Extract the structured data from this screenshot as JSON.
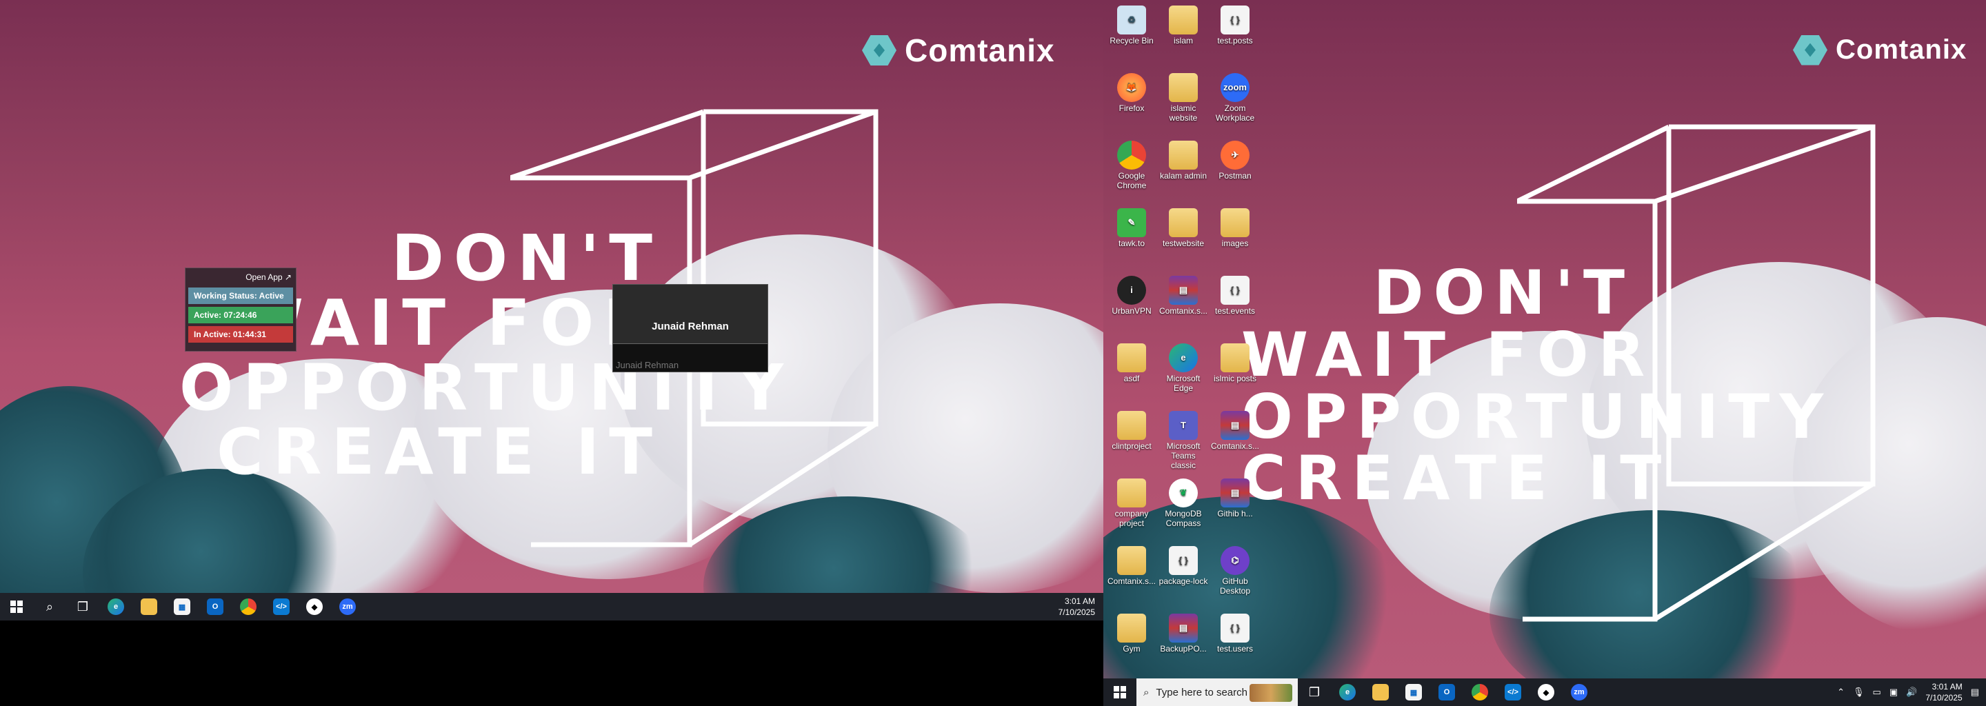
{
  "left_monitor": {
    "logo": "Comtanix",
    "quote": [
      "DON'T",
      "WAIT FOR",
      "OPPORTUNITY",
      "CREATE IT"
    ],
    "widget": {
      "open_app": "Open App ↗",
      "status": "Working Status: Active",
      "active": "Active: 07:24:46",
      "inactive": "In Active: 01:44:31",
      "colors": {
        "status": "#5e8fa3",
        "active": "#3aa35a",
        "inactive": "#c43a3a"
      }
    },
    "preview": {
      "title": "Junaid Rehman",
      "subtitle": "Junaid Rehman"
    },
    "taskbar": {
      "apps": [
        "start-icon",
        "search-icon",
        "task-view-icon",
        "edge-icon",
        "file-explorer-icon",
        "store-icon",
        "outlook-icon",
        "chrome-icon",
        "vscode-icon",
        "urbanvpn-icon",
        "zoom-icon"
      ],
      "time": "3:01 AM",
      "date": "7/10/2025"
    }
  },
  "right_monitor": {
    "logo": "Comtanix",
    "quote": [
      "DON'T",
      "WAIT FOR",
      "OPPORTUNITY",
      "CREATE IT"
    ],
    "desktop_icons": [
      {
        "label": "Recycle Bin",
        "icon": "recycle-bin-icon"
      },
      {
        "label": "islam",
        "icon": "folder-icon"
      },
      {
        "label": "test.posts",
        "icon": "json-file-icon"
      },
      {
        "label": "Firefox",
        "icon": "firefox-icon"
      },
      {
        "label": "islamic website",
        "icon": "folder-icon"
      },
      {
        "label": "Zoom Workplace",
        "icon": "zoom-icon"
      },
      {
        "label": "Google Chrome",
        "icon": "chrome-icon"
      },
      {
        "label": "kalam admin",
        "icon": "folder-icon"
      },
      {
        "label": "Postman",
        "icon": "postman-icon"
      },
      {
        "label": "tawk.to",
        "icon": "tawk-icon"
      },
      {
        "label": "testwebsite",
        "icon": "folder-icon"
      },
      {
        "label": "images",
        "icon": "folder-icon"
      },
      {
        "label": "UrbanVPN",
        "icon": "urbanvpn-icon"
      },
      {
        "label": "Comtanix.s...",
        "icon": "winrar-icon"
      },
      {
        "label": "test.events",
        "icon": "json-file-icon"
      },
      {
        "label": "asdf",
        "icon": "folder-icon"
      },
      {
        "label": "Microsoft Edge",
        "icon": "edge-icon"
      },
      {
        "label": "islmic posts",
        "icon": "folder-icon"
      },
      {
        "label": "clintproject",
        "icon": "folder-icon"
      },
      {
        "label": "Microsoft Teams classic",
        "icon": "teams-icon"
      },
      {
        "label": "Comtanix.s...",
        "icon": "winrar-icon"
      },
      {
        "label": "company project",
        "icon": "folder-icon"
      },
      {
        "label": "MongoDB Compass",
        "icon": "mongodb-icon"
      },
      {
        "label": "Githib h...",
        "icon": "winrar-icon"
      },
      {
        "label": "Comtanix.s...",
        "icon": "folder-icon"
      },
      {
        "label": "package-lock",
        "icon": "json-file-icon"
      },
      {
        "label": "GitHub Desktop",
        "icon": "github-icon"
      },
      {
        "label": "Gym",
        "icon": "folder-icon"
      },
      {
        "label": "BackupPO...",
        "icon": "winrar-icon"
      },
      {
        "label": "test.users",
        "icon": "json-file-icon"
      }
    ],
    "taskbar": {
      "search_placeholder": "Type here to search",
      "apps": [
        "task-view-icon",
        "edge-icon",
        "file-explorer-icon",
        "store-icon",
        "outlook-icon",
        "chrome-icon",
        "vscode-icon",
        "urbanvpn-icon",
        "zoom-icon"
      ],
      "time": "3:01 AM",
      "date": "7/10/2025"
    }
  }
}
